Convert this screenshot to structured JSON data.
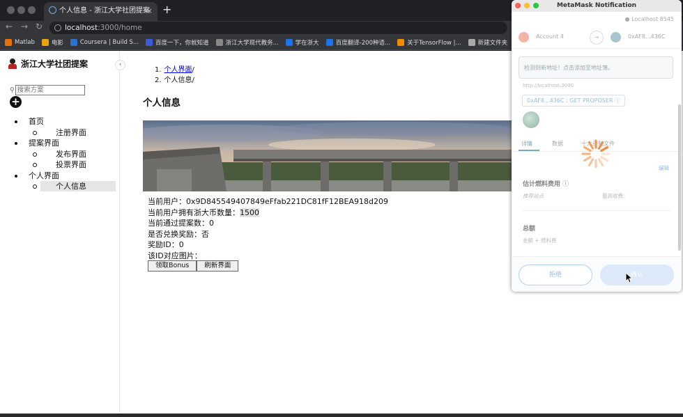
{
  "browser": {
    "tab_title": "个人信息 - 浙江大学社团提案",
    "tab_close": "×",
    "new_tab": "+",
    "back": "←",
    "forward": "→",
    "reload": "↻",
    "url_host": "localhost",
    "url_path": ":3000/home",
    "bookmarks": [
      {
        "label": "Matlab",
        "color": "#e8710a"
      },
      {
        "label": "电影",
        "color": "#e8a40a"
      },
      {
        "label": "Coursera | Build S...",
        "color": "#2a73cc"
      },
      {
        "label": "百度一下，你就知道",
        "color": "#3b5bdb"
      },
      {
        "label": "浙江大学现代教务...",
        "color": "#888888"
      },
      {
        "label": "学在浙大",
        "color": "#1a73e8"
      },
      {
        "label": "百度翻译-200种语...",
        "color": "#1a73e8"
      },
      {
        "label": "关于TensorFlow |...",
        "color": "#f08c00"
      },
      {
        "label": "新建文件夹",
        "color": "#aaaaaa"
      }
    ]
  },
  "sidebar": {
    "title": "浙江大学社团提案",
    "collapse": "‹",
    "search_placeholder": "搜索方案",
    "add": "+",
    "menu": [
      {
        "label": "首页",
        "children": [
          {
            "label": "注册界面",
            "selected": false
          }
        ]
      },
      {
        "label": "提案界面",
        "children": [
          {
            "label": "发布界面",
            "selected": false
          },
          {
            "label": "投票界面",
            "selected": false
          }
        ]
      },
      {
        "label": "个人界面",
        "children": [
          {
            "label": "个人信息",
            "selected": true
          }
        ]
      }
    ]
  },
  "main": {
    "breadcrumb": [
      {
        "num": "1.",
        "label": "个人界面",
        "link": true,
        "sep": "/"
      },
      {
        "num": "2.",
        "label": "个人信息",
        "link": false,
        "sep": "/"
      }
    ],
    "page_title": "个人信息",
    "info": {
      "user_label": "当前用户：",
      "user_value": "0x9D845549407849eFfab221DC81fF12BEA918d209",
      "balance_label": "当前用户拥有浙大币数量：",
      "balance_value": "1500",
      "passed_label": "当前通过提案数：",
      "passed_value": "0",
      "redeemed_label": "是否兑换奖励：",
      "redeemed_value": "否",
      "reward_label": "奖励ID：",
      "reward_value": "0",
      "image_label": "该ID对应图片："
    },
    "buttons": {
      "claim": "领取Bonus",
      "refresh": "刷新界面"
    }
  },
  "metamask": {
    "title": "MetaMask Notification",
    "network": "Localhost 8545",
    "account": "Account 4",
    "to_address": "0xAF8...436C",
    "notice": "检测到新地址！点击添加至地址簿。",
    "origin": "http://localhost:3000",
    "method_pill": "0xAF8...436C : GET PROPOSER",
    "tabs": [
      "详情",
      "数据",
      "十六进制文件"
    ],
    "edit": "编辑",
    "gas_label": "估计燃料费用",
    "site_suggested": "推荐站点",
    "max_fee": "最高收费：",
    "total_label": "总额",
    "amount_label": "金额 + 燃料费",
    "reject": "拒绝",
    "confirm": "确认"
  }
}
